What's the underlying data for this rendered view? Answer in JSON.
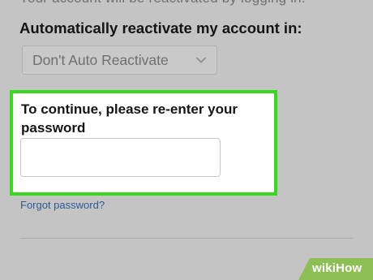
{
  "top_partial_text": "Automatically reactivate my account in:",
  "reactivate": {
    "label": "Automatically reactivate my account in:",
    "selected_value": "Don't Auto Reactivate",
    "chevron_icon": "chevron-down-icon"
  },
  "password_section": {
    "label": "To continue, please re-enter your password",
    "input_value": "",
    "highlight_color": "#36d91c"
  },
  "forgot_password": {
    "label": "Forgot password?",
    "color": "#2f5a91"
  },
  "watermark": {
    "brand": "wikiHow",
    "color": "#8dbf56"
  }
}
